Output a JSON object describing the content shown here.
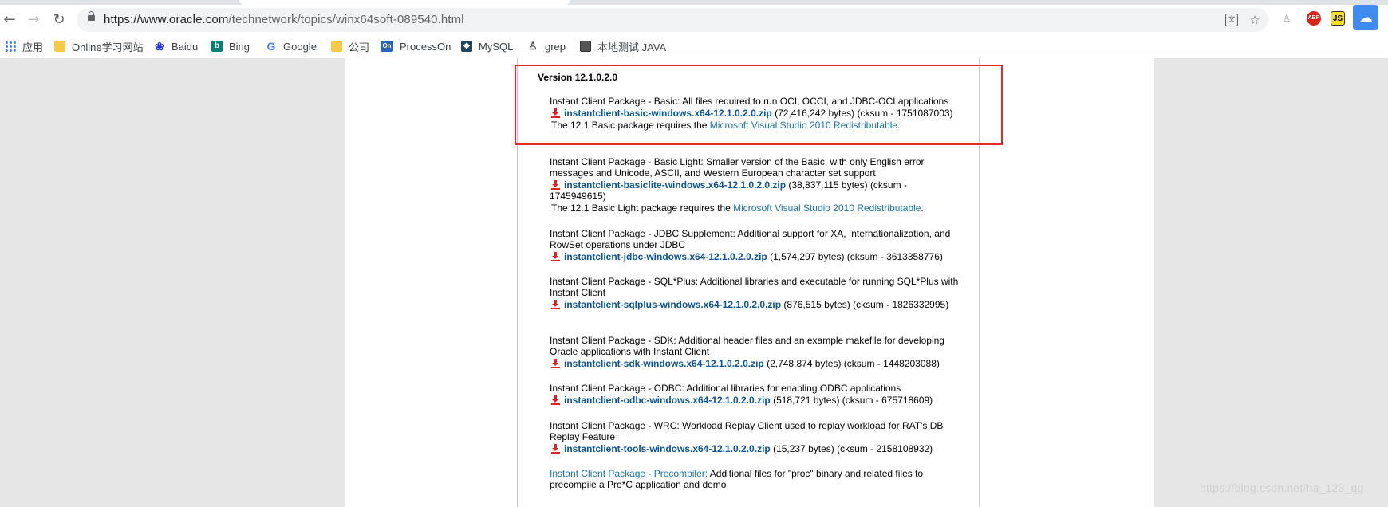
{
  "browser": {
    "url_host": "https://www.oracle.com",
    "url_path": "/technetwork/topics/winx64soft-089540.html",
    "nav": {
      "back": "←",
      "forward": "→",
      "reload": "↻"
    },
    "extensions": {
      "abp": "ABP",
      "js": "JS"
    }
  },
  "bookmarks": [
    {
      "label": "应用",
      "icon": "apps-icon"
    },
    {
      "label": "Online学习网站",
      "icon": "folder-icon"
    },
    {
      "label": "Baidu",
      "icon": "baidu-icon"
    },
    {
      "label": "Bing",
      "icon": "bing-icon"
    },
    {
      "label": "Google",
      "icon": "google-icon"
    },
    {
      "label": "公司",
      "icon": "folder-icon"
    },
    {
      "label": "ProcessOn",
      "icon": "processon-icon"
    },
    {
      "label": "MySQL",
      "icon": "mysql-icon"
    },
    {
      "label": "grep",
      "icon": "grep-icon"
    },
    {
      "label": "本地测试 JAVA",
      "icon": "image-icon"
    }
  ],
  "page": {
    "version": "Version 12.1.0.2.0",
    "packages": [
      {
        "desc": "Instant Client Package - Basic: All files required to run OCI, OCCI, and JDBC-OCI applications",
        "file": "instantclient-basic-windows.x64-12.1.0.2.0.zip",
        "meta": " (72,416,242 bytes) (cksum - 1751087003)",
        "note_pre": "The 12.1 Basic package requires the ",
        "note_link": "Microsoft Visual Studio 2010 Redistributable",
        "note_post": "."
      },
      {
        "desc": "Instant Client Package - Basic Light: Smaller version of the Basic, with only English error messages and Unicode, ASCII, and Western European character set support",
        "file": "instantclient-basiclite-windows.x64-12.1.0.2.0.zip",
        "meta": " (38,837,115 bytes) (cksum - 1745949615)",
        "note_pre": "The 12.1 Basic Light package requires the ",
        "note_link": "Microsoft Visual Studio 2010 Redistributable",
        "note_post": "."
      },
      {
        "desc": "Instant Client Package - JDBC Supplement: Additional support for XA, Internationalization, and RowSet operations under JDBC",
        "file": "instantclient-jdbc-windows.x64-12.1.0.2.0.zip",
        "meta": " (1,574,297 bytes) (cksum - 3613358776)"
      },
      {
        "desc": "Instant Client Package - SQL*Plus: Additional libraries and executable for running SQL*Plus with Instant Client",
        "file": "instantclient-sqlplus-windows.x64-12.1.0.2.0.zip",
        "meta": " (876,515 bytes) (cksum - 1826332995)"
      },
      {
        "desc": "Instant Client Package - SDK: Additional header files and an example makefile for developing Oracle applications with Instant Client",
        "file": "instantclient-sdk-windows.x64-12.1.0.2.0.zip",
        "meta": " (2,748,874 bytes) (cksum - 1448203088)"
      },
      {
        "desc": "Instant Client Package - ODBC: Additional libraries for enabling ODBC applications",
        "file": "instantclient-odbc-windows.x64-12.1.0.2.0.zip",
        "meta": " (518,721 bytes) (cksum - 675718609)"
      },
      {
        "desc": "Instant Client Package - WRC: Workload Replay Client used to replay workload for RAT's DB Replay Feature",
        "file": "instantclient-tools-windows.x64-12.1.0.2.0.zip",
        "meta": " (15,237 bytes) (cksum - 2158108932)"
      }
    ],
    "precompiler": {
      "link": "Instant Client Package - Precompiler:",
      "desc": " Additional files for \"proc\" binary and related files to precompile a Pro*C application and demo"
    }
  },
  "watermark": "https://blog.csdn.net/ha_123_qq",
  "colors": {
    "highlight_border": "#e5262a",
    "link": "#0b5394",
    "download_icon": "#e1221e"
  }
}
